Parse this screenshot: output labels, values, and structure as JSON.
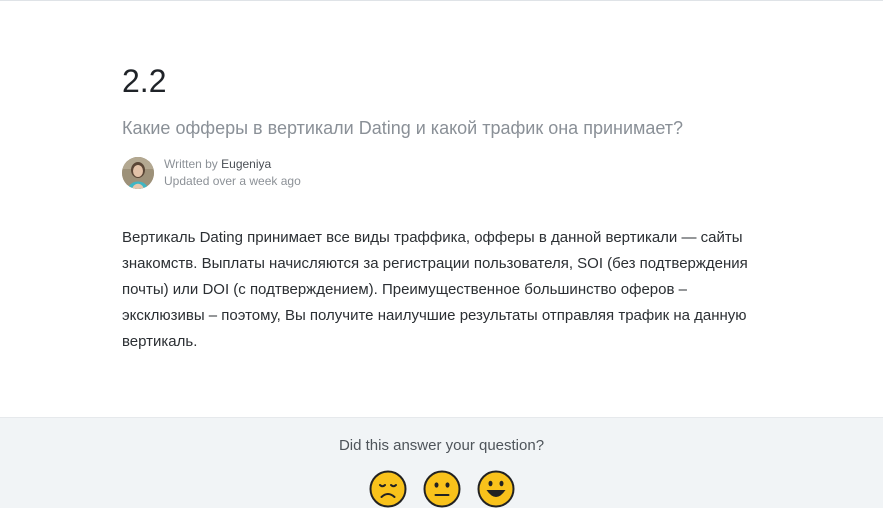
{
  "article": {
    "title": "2.2",
    "subtitle": "Какие офферы в вертикали Dating и какой трафик она принимает?",
    "author": {
      "written_by_prefix": "Written by ",
      "name": "Eugeniya",
      "updated": "Updated over a week ago"
    },
    "body": "Вертикаль Dating принимает все виды траффика, офферы в данной вертикали — сайты знакомств. Выплаты начисляются за регистрации пользователя, SOI (без подтверждения почты) или DOI (с подтверждением). Преимущественное большинство оферов – эксклюзивы – поэтому, Вы получите наилучшие результаты отправляя трафик на данную вертикаль."
  },
  "feedback": {
    "question": "Did this answer your question?",
    "reactions": [
      {
        "icon": "disappointed-face-icon"
      },
      {
        "icon": "neutral-face-icon"
      },
      {
        "icon": "smiley-face-icon"
      }
    ]
  },
  "colors": {
    "feedback_background": "#f1f4f6",
    "emoji_yellow": "#f9c21b",
    "text_muted": "#8a9097"
  }
}
